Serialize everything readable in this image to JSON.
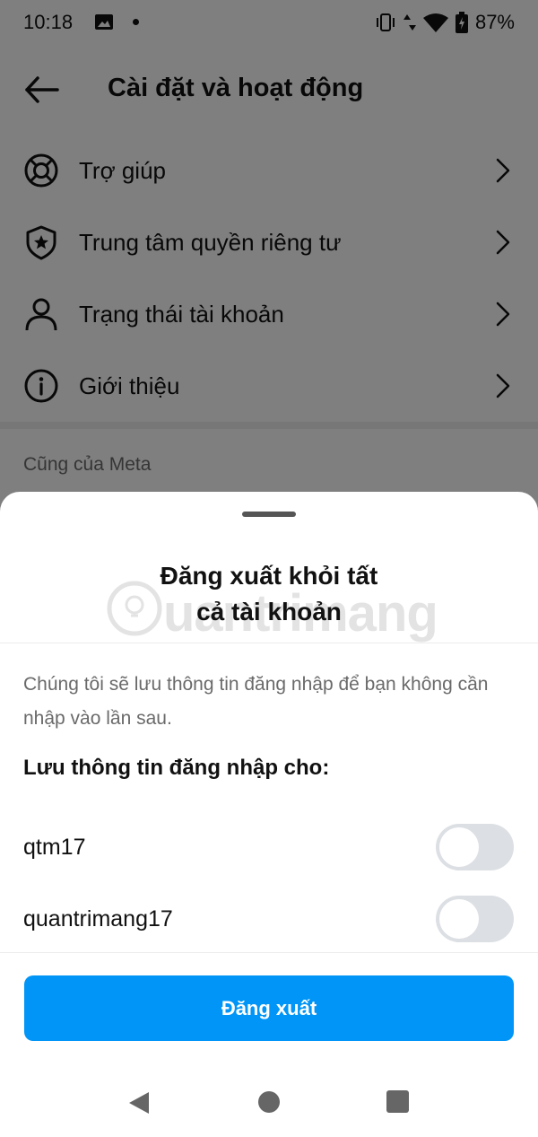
{
  "status_bar": {
    "time": "10:18",
    "battery": "87%"
  },
  "header": {
    "title": "Cài đặt và hoạt động"
  },
  "menu": [
    {
      "label": "Trợ giúp",
      "icon": "lifebuoy-icon"
    },
    {
      "label": "Trung tâm quyền riêng tư",
      "icon": "shield-star-icon"
    },
    {
      "label": "Trạng thái tài khoản",
      "icon": "person-icon"
    },
    {
      "label": "Giới thiệu",
      "icon": "info-icon"
    }
  ],
  "section": {
    "title": "Cũng của Meta"
  },
  "sheet": {
    "title_line1": "Đăng xuất khỏi tất",
    "title_line2": "cả tài khoản",
    "watermark": "uantrimang",
    "description": "Chúng tôi sẽ lưu thông tin đăng nhập để bạn không cần nhập vào lần sau.",
    "save_heading": "Lưu thông tin đăng nhập cho:",
    "accounts": [
      {
        "name": "qtm17",
        "save_enabled": false
      },
      {
        "name": "quantrimang17",
        "save_enabled": false
      }
    ],
    "logout_label": "Đăng xuất"
  },
  "colors": {
    "primary_button": "#0095f6",
    "toggle_off": "#dcdfe3"
  }
}
